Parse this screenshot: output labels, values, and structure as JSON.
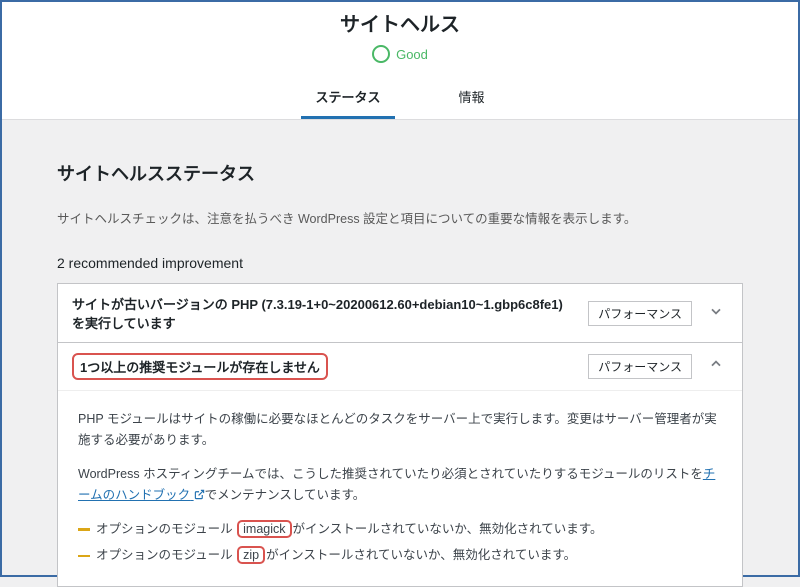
{
  "header": {
    "title": "サイトヘルス",
    "status_label": "Good"
  },
  "tabs": {
    "status": "ステータス",
    "info": "情報"
  },
  "section": {
    "title": "サイトヘルスステータス",
    "description": "サイトヘルスチェックは、注意を払うべき WordPress 設定と項目についての重要な情報を表示します。",
    "rec_heading": "2 recommended improvement"
  },
  "issues": {
    "php_version": {
      "title": "サイトが古いバージョンの PHP (7.3.19-1+0~20200612.60+debian10~1.gbp6c8fe1) を実行しています",
      "badge": "パフォーマンス"
    },
    "modules": {
      "title": "1つ以上の推奨モジュールが存在しません",
      "badge": "パフォーマンス",
      "body_p1": "PHP モジュールはサイトの稼働に必要なほとんどのタスクをサーバー上で実行します。変更はサーバー管理者が実施する必要があります。",
      "body_p2_pre": "WordPress ホスティングチームでは、こうした推奨されていたり必須とされていたりするモジュールのリストを",
      "handbook_link": "チームのハンドブック",
      "body_p2_post": "でメンテナンスしています。",
      "item_prefix": "オプションのモジュール",
      "item_suffix": "がインストールされていないか、無効化されています。",
      "mod1": "imagick",
      "mod2": "zip"
    }
  }
}
